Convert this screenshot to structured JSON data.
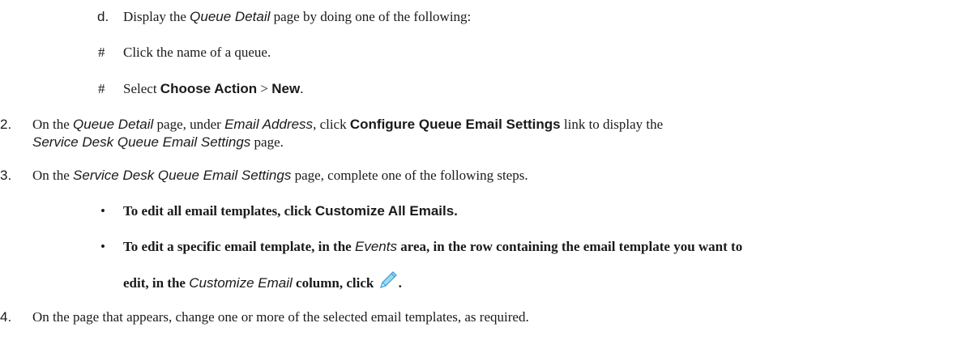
{
  "step_d": {
    "marker": "d.",
    "text_a": "Display the ",
    "page_name": "Queue Detail",
    "text_b": " page by doing one of the following:"
  },
  "sub_items": [
    {
      "marker": "#",
      "text": "Click the name of a queue."
    },
    {
      "marker": "#",
      "text_a": "Select ",
      "bold_a": "Choose Action",
      "text_b": " > ",
      "bold_b": "New",
      "text_c": "."
    }
  ],
  "step_2": {
    "marker": "2.",
    "text_a": "On the ",
    "page_name": "Queue Detail",
    "text_b": " page, under ",
    "section": "Email Address",
    "text_c": ", click ",
    "link_name": "Configure Queue Email Settings",
    "text_d": " link to display the",
    "page_name_2": "Service Desk Queue Email Settings",
    "text_e": " page."
  },
  "step_3": {
    "marker": "3.",
    "text_a": "On the  ",
    "page_name": "Service Desk Queue Email Settings",
    "text_b": " page, complete one of the following steps."
  },
  "bullets": [
    {
      "marker": "•",
      "text_a": "To edit all email templates, click ",
      "bold": "Customize All Emails."
    },
    {
      "marker": "•",
      "text_a": "To edit a specific email template, in the ",
      "area": "Events",
      "text_b": " area, in the row containing the email template you want to",
      "text_c": "edit, in the ",
      "column": "Customize Email",
      "text_d": " column, click ",
      "icon": "pencil-edit-icon",
      "text_e": "."
    }
  ],
  "step_4": {
    "marker": "4.",
    "text": "On the page that appears, change one or more of the selected email templates, as required."
  },
  "colors": {
    "text": "#1a1a1a",
    "pencil_light": "#9fd8f0",
    "pencil_dark": "#3a9fd0"
  }
}
